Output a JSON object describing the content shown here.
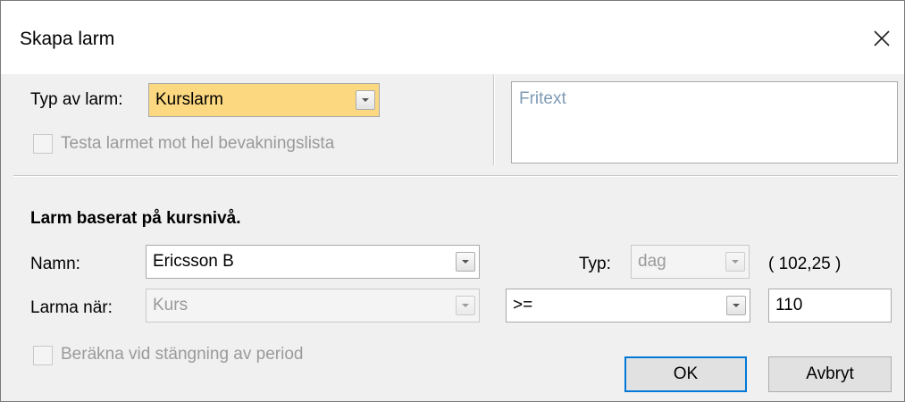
{
  "window": {
    "title": "Skapa larm"
  },
  "alarm_type": {
    "label": "Typ av larm:",
    "value": "Kurslarm"
  },
  "test_checkbox": {
    "label": "Testa larmet mot hel bevakningslista",
    "checked": false
  },
  "freetext": {
    "placeholder": "Fritext",
    "value": ""
  },
  "section": {
    "heading": "Larm baserat på kursnivå."
  },
  "name": {
    "label": "Namn:",
    "value": "Ericsson B"
  },
  "type": {
    "label": "Typ:",
    "value": "dag",
    "current_value": "( 102,25 )"
  },
  "trigger": {
    "label": "Larma när:",
    "field_value": "Kurs",
    "operator": ">=",
    "threshold": "110"
  },
  "period_checkbox": {
    "label": "Beräkna vid stängning av period",
    "checked": false
  },
  "buttons": {
    "ok": "OK",
    "cancel": "Avbryt"
  },
  "colors": {
    "highlight": "#fcd881",
    "focus_border": "#0078d7",
    "disabled_text": "#9a9a9a",
    "freetext_placeholder": "#7f9bb5"
  }
}
